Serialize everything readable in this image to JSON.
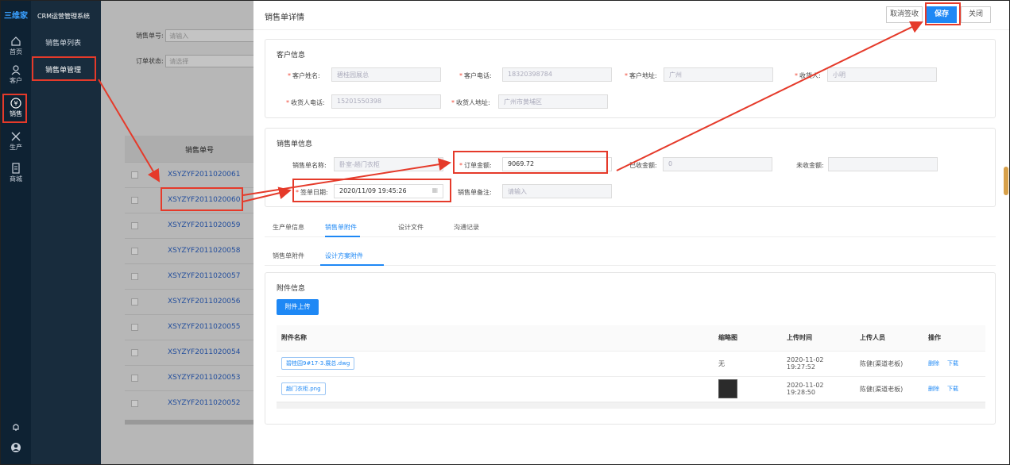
{
  "rail": {
    "logo": "三维家",
    "items": [
      {
        "label": "首页",
        "icon": "home-icon"
      },
      {
        "label": "客户",
        "icon": "user-icon"
      },
      {
        "label": "销售",
        "icon": "yen-icon"
      },
      {
        "label": "生产",
        "icon": "tools-icon"
      },
      {
        "label": "商城",
        "icon": "shop-icon"
      }
    ]
  },
  "subnav": {
    "system_name": "CRM运营管理系统",
    "items": [
      "销售单列表",
      "销售单管理"
    ]
  },
  "list": {
    "filter_no_label": "销售单号:",
    "filter_no_placeholder": "请输入",
    "filter_status_label": "订单状态:",
    "filter_status_placeholder": "请选择",
    "column_header": "销售单号",
    "rows": [
      "XSYZYF2011020061",
      "XSYZYF2011020060",
      "XSYZYF2011020059",
      "XSYZYF2011020058",
      "XSYZYF2011020057",
      "XSYZYF2011020056",
      "XSYZYF2011020055",
      "XSYZYF2011020054",
      "XSYZYF2011020053",
      "XSYZYF2011020052"
    ]
  },
  "detail": {
    "title": "销售单详情",
    "buttons": {
      "cancel_sign": "取消签收",
      "save": "保存",
      "close": "关闭"
    },
    "customer": {
      "section_title": "客户信息",
      "name_label": "客户姓名:",
      "name_value": "碧桂园展总",
      "phone_label": "客户电话:",
      "phone_value": "18320398784",
      "address_label": "客户地址:",
      "address_value": "广州",
      "receiver_label": "收货人:",
      "receiver_value": "小明",
      "receiver_phone_label": "收货人电话:",
      "receiver_phone_value": "15201550398",
      "receiver_addr_label": "收货人地址:",
      "receiver_addr_value": "广州市黄埔区"
    },
    "order": {
      "section_title": "销售单信息",
      "name_label": "销售单名称:",
      "name_value": "卧室-趟门衣柜",
      "amount_label": "订单金额:",
      "amount_value": "9069.72",
      "received_label": "已收金额:",
      "received_value": "0",
      "unreceived_label": "未收金额:",
      "unreceived_value": "",
      "sign_date_label": "签单日期:",
      "sign_date_value": "2020/11/09 19:45:26",
      "remark_label": "销售单备注:",
      "remark_placeholder": "请输入"
    },
    "tabs": [
      "生产单信息",
      "销售单附件",
      "设计文件",
      "沟通记录"
    ],
    "subtabs": [
      "销售单附件",
      "设计方案附件"
    ],
    "attachments": {
      "section_title": "附件信息",
      "upload_label": "附件上传",
      "headers": [
        "附件名称",
        "缩略图",
        "上传时间",
        "上传人员",
        "操作"
      ],
      "rows": [
        {
          "name": "碧桂园9#17-3.展总.dwg",
          "thumb": "无",
          "time": "2020-11-02 19:27:52",
          "uploader": "陈健(渠道老板)",
          "delete": "删除",
          "download": "下载"
        },
        {
          "name": "趟门衣柜.png",
          "thumb": "",
          "time": "2020-11-02 19:28:50",
          "uploader": "陈健(渠道老板)",
          "delete": "删除",
          "download": "下载"
        }
      ]
    }
  },
  "colors": {
    "accent": "#1e88f5",
    "annotation": "#e53a2a",
    "sidebar": "#0e2233"
  }
}
